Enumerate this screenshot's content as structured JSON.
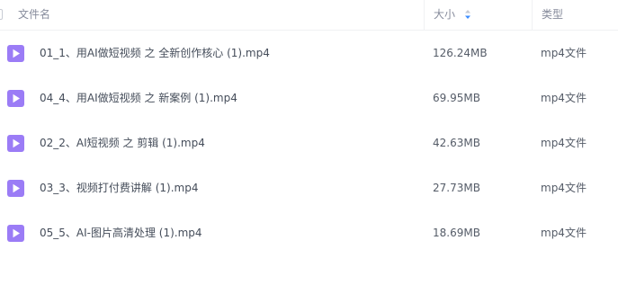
{
  "header": {
    "name_label": "文件名",
    "size_label": "大小",
    "type_label": "类型"
  },
  "colors": {
    "accent": "#3b8cff",
    "video_icon": "#9b7cf6"
  },
  "files": [
    {
      "name": "01_1、用AI做短视频 之 全新创作核心 (1).mp4",
      "size": "126.24MB",
      "type": "mp4文件",
      "icon": "video-file-icon"
    },
    {
      "name": "04_4、用AI做短视频 之 新案例 (1).mp4",
      "size": "69.95MB",
      "type": "mp4文件",
      "icon": "video-file-icon"
    },
    {
      "name": "02_2、AI短视频 之 剪辑 (1).mp4",
      "size": "42.63MB",
      "type": "mp4文件",
      "icon": "video-file-icon"
    },
    {
      "name": "03_3、视频打付费讲解 (1).mp4",
      "size": "27.73MB",
      "type": "mp4文件",
      "icon": "video-file-icon"
    },
    {
      "name": "05_5、AI-图片高清处理 (1).mp4",
      "size": "18.69MB",
      "type": "mp4文件",
      "icon": "video-file-icon"
    }
  ]
}
